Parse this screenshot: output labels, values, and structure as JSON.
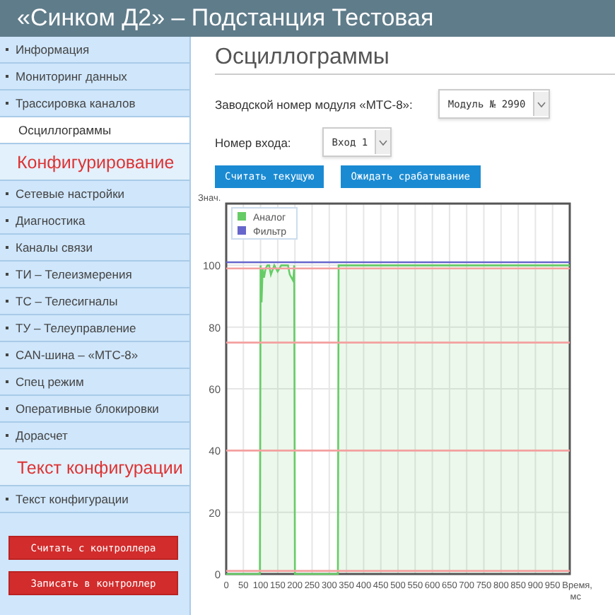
{
  "header": {
    "title": "«Синком Д2» – Подстанция Тестовая"
  },
  "sidebar": {
    "items": [
      {
        "kind": "item",
        "label": "Информация",
        "selected": false
      },
      {
        "kind": "item",
        "label": "Мониторинг данных",
        "selected": false
      },
      {
        "kind": "item",
        "label": "Трассировка каналов",
        "selected": false
      },
      {
        "kind": "item",
        "label": "Осциллограммы",
        "selected": true
      },
      {
        "kind": "section",
        "label": "Конфигурирование"
      },
      {
        "kind": "item",
        "label": "Сетевые настройки",
        "selected": false
      },
      {
        "kind": "item",
        "label": "Диагностика",
        "selected": false
      },
      {
        "kind": "item",
        "label": "Каналы связи",
        "selected": false
      },
      {
        "kind": "item",
        "label": "ТИ – Телеизмерения",
        "selected": false
      },
      {
        "kind": "item",
        "label": "ТС – Телесигналы",
        "selected": false
      },
      {
        "kind": "item",
        "label": "ТУ – Телеуправление",
        "selected": false
      },
      {
        "kind": "item",
        "label": "CAN-шина – «МТС-8»",
        "selected": false
      },
      {
        "kind": "item",
        "label": "Спец режим",
        "selected": false
      },
      {
        "kind": "item",
        "label": "Оперативные блокировки",
        "selected": false
      },
      {
        "kind": "item",
        "label": "Дорасчет",
        "selected": false
      },
      {
        "kind": "section",
        "label": "Текст конфигурации"
      },
      {
        "kind": "item",
        "label": "Текст конфигурации",
        "selected": false
      }
    ],
    "buttons": [
      "Считать с контроллера",
      "Записать в контроллер"
    ]
  },
  "content": {
    "title": "Осциллограммы",
    "fields": [
      {
        "label": "Заводской номер модуля «МТС-8»:",
        "value": "Модуль № 2990"
      },
      {
        "label": "Номер входа:",
        "value": "Вход 1"
      }
    ],
    "buttons": [
      "Считать текущую",
      "Ожидать срабатывание"
    ],
    "chart": {
      "chart_data": {
        "type": "area",
        "ylabel": "Знач.",
        "xlabel": "Время, мс",
        "xlim": [
          0,
          1000
        ],
        "ylim": [
          0,
          120
        ],
        "xticks": [
          0,
          50,
          100,
          150,
          200,
          250,
          300,
          350,
          400,
          450,
          500,
          550,
          600,
          650,
          700,
          750,
          800,
          850,
          900,
          950
        ],
        "yticks": [
          0,
          20,
          40,
          60,
          80,
          100
        ],
        "x": [
          0,
          98,
          100,
          103,
          106,
          110,
          115,
          120,
          125,
          130,
          140,
          150,
          160,
          170,
          180,
          185,
          190,
          195,
          198,
          200,
          325,
          327,
          330,
          1000
        ],
        "series": [
          {
            "name": "Аналог",
            "type": "area",
            "color": "#66cc66",
            "values": [
              0,
              0,
              100,
              88,
              99,
              96,
              99,
              100,
              100,
              97,
              100,
              98,
              100,
              100,
              100,
              97,
              96,
              95,
              100,
              0,
              0,
              100,
              100,
              100
            ]
          },
          {
            "name": "Фильтр",
            "type": "line",
            "color": "#6666cc",
            "values": [
              101,
              101,
              101,
              101,
              101,
              101,
              101,
              101,
              101,
              101,
              101,
              101,
              101,
              101,
              101,
              101,
              101,
              101,
              101,
              101,
              101,
              101,
              101,
              101
            ]
          },
          {
            "type": "line",
            "color": "#f4a0a0",
            "values": [
              99,
              99,
              99,
              99,
              99,
              99,
              99,
              99,
              99,
              99,
              99,
              99,
              99,
              99,
              99,
              99,
              99,
              99,
              99,
              99,
              99,
              99,
              99,
              99
            ]
          },
          {
            "type": "line",
            "color": "#f4a0a0",
            "values": [
              75,
              75,
              75,
              75,
              75,
              75,
              75,
              75,
              75,
              75,
              75,
              75,
              75,
              75,
              75,
              75,
              75,
              75,
              75,
              75,
              75,
              75,
              75,
              75
            ]
          },
          {
            "type": "line",
            "color": "#f4a0a0",
            "values": [
              40,
              40,
              40,
              40,
              40,
              40,
              40,
              40,
              40,
              40,
              40,
              40,
              40,
              40,
              40,
              40,
              40,
              40,
              40,
              40,
              40,
              40,
              40,
              40
            ]
          },
          {
            "type": "line",
            "color": "#f4a0a0",
            "values": [
              1,
              1,
              1,
              1,
              1,
              1,
              1,
              1,
              1,
              1,
              1,
              1,
              1,
              1,
              1,
              1,
              1,
              1,
              1,
              1,
              1,
              1,
              1,
              1
            ]
          }
        ],
        "grid": true,
        "legend": "upper left"
      }
    }
  }
}
